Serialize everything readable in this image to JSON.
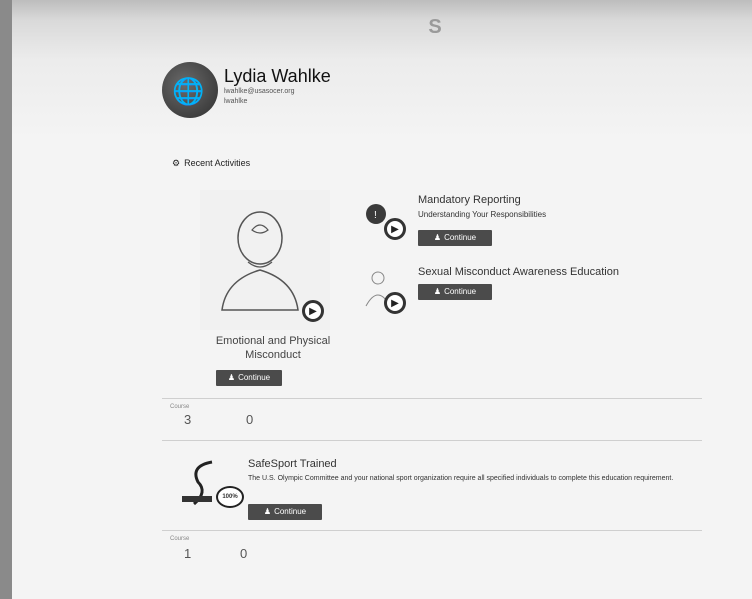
{
  "header": {
    "logo_glyph": "S",
    "user": {
      "name": "Lydia Wahlke",
      "email": "lwahlke@usasocer.org",
      "id": "lwahlke",
      "avatar_icon": "globe-icon"
    }
  },
  "recent": {
    "title": "Recent Activities",
    "icon": "gear-icon"
  },
  "featured": {
    "title_line1": "Emotional and Physical",
    "title_line2": "Misconduct",
    "button": "Continue",
    "button_icon": "user-icon"
  },
  "courses": [
    {
      "title": "Mandatory Reporting",
      "subtitle": "Understanding Your Responsibilities",
      "button": "Continue"
    },
    {
      "title": "Sexual Misconduct Awareness Education",
      "button": "Continue"
    }
  ],
  "stats_top": {
    "label1": "Course",
    "value1": "3",
    "value2": "0"
  },
  "safesport": {
    "title": "SafeSport Trained",
    "description": "The U.S. Olympic Committee and your national sport organization require all specified individuals to complete this education requirement.",
    "badge": "100%",
    "button": "Continue"
  },
  "stats_bottom": {
    "label1": "Course",
    "value1": "1",
    "value2": "0"
  },
  "colors": {
    "button_bg": "#4b4b4b",
    "background": "#f4f4f4"
  }
}
